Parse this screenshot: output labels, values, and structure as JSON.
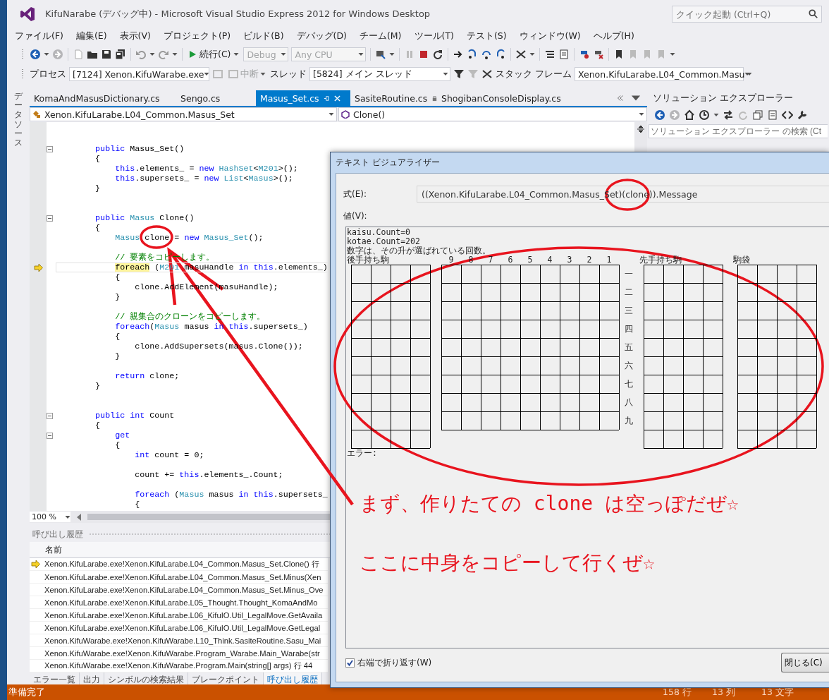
{
  "window": {
    "title": "KifuNarabe (デバッグ中) - Microsoft Visual Studio Express 2012 for Windows Desktop",
    "quick_launch": {
      "placeholder": "クイック起動 (Ctrl+Q)"
    }
  },
  "menu": [
    "ファイル(F)",
    "編集(E)",
    "表示(V)",
    "プロジェクト(P)",
    "ビルド(B)",
    "デバッグ(D)",
    "チーム(M)",
    "ツール(T)",
    "テスト(S)",
    "ウィンドウ(W)",
    "ヘルプ(H)"
  ],
  "toolbar": {
    "continue": "続行(C)",
    "configuration": {
      "value": "Debug",
      "disabled": true
    },
    "platform": {
      "value": "Any CPU",
      "disabled": true
    }
  },
  "debug_location": {
    "process_label": "プロセス",
    "process": "[7124] Xenon.KifuWarabe.exe",
    "suspend": {
      "label": "中断",
      "disabled": true
    },
    "thread_label": "スレッド",
    "thread": "[5824] メイン スレッド",
    "stack_frame_label": "スタック フレーム",
    "stack_frame": "Xenon.KifuLarabe.L04_Common.Masu"
  },
  "side_tab": "データソース",
  "tabs": [
    {
      "label": "KomaAndMasusDictionary.cs",
      "selected": false,
      "locked": false
    },
    {
      "label": "Sengo.cs",
      "selected": false,
      "locked": false
    },
    {
      "label": "Masus_Set.cs",
      "selected": true,
      "locked": false
    },
    {
      "label": "SasiteRoutine.cs",
      "selected": false,
      "locked": true
    },
    {
      "label": "ShogibanConsoleDisplay.cs",
      "selected": false,
      "locked": false
    }
  ],
  "nav": {
    "type": "Xenon.KifuLarabe.L04_Common.Masus_Set",
    "member": "Clone()"
  },
  "code": [
    {
      "fold": true,
      "current": false,
      "tokens": [
        {
          "kind": "keyword",
          "text": "        public"
        },
        {
          "kind": "plain",
          "text": " Masus_Set()"
        }
      ]
    },
    {
      "fold": false,
      "current": false,
      "tokens": [
        {
          "kind": "plain",
          "text": "        {"
        }
      ]
    },
    {
      "fold": false,
      "current": false,
      "tokens": [
        {
          "kind": "keyword",
          "text": "            this"
        },
        {
          "kind": "plain",
          "text": ".elements_ = "
        },
        {
          "kind": "keyword",
          "text": "new"
        },
        {
          "kind": "type",
          "text": " HashSet"
        },
        {
          "kind": "plain",
          "text": "<"
        },
        {
          "kind": "type",
          "text": "M201"
        },
        {
          "kind": "plain",
          "text": ">();"
        }
      ]
    },
    {
      "fold": false,
      "current": false,
      "tokens": [
        {
          "kind": "keyword",
          "text": "            this"
        },
        {
          "kind": "plain",
          "text": ".supersets_ = "
        },
        {
          "kind": "keyword",
          "text": "new"
        },
        {
          "kind": "type",
          "text": " List"
        },
        {
          "kind": "plain",
          "text": "<"
        },
        {
          "kind": "type",
          "text": "Masus"
        },
        {
          "kind": "plain",
          "text": ">();"
        }
      ]
    },
    {
      "fold": false,
      "current": false,
      "tokens": [
        {
          "kind": "plain",
          "text": "        }"
        }
      ]
    },
    {
      "fold": false,
      "current": false
    },
    {
      "fold": false,
      "current": false
    },
    {
      "fold": true,
      "current": false,
      "tokens": [
        {
          "kind": "keyword",
          "text": "        public"
        },
        {
          "kind": "type",
          "text": " Masus"
        },
        {
          "kind": "plain",
          "text": " Clone()"
        }
      ]
    },
    {
      "fold": false,
      "current": false,
      "tokens": [
        {
          "kind": "plain",
          "text": "        {"
        }
      ]
    },
    {
      "fold": false,
      "current": false,
      "tokens": [
        {
          "kind": "type",
          "text": "            Masus"
        },
        {
          "kind": "plain",
          "text": " clone = "
        },
        {
          "kind": "keyword",
          "text": "new"
        },
        {
          "kind": "type",
          "text": " Masus_Set"
        },
        {
          "kind": "plain",
          "text": "();"
        }
      ]
    },
    {
      "fold": false,
      "current": false
    },
    {
      "fold": false,
      "current": false,
      "tokens": [
        {
          "kind": "comment",
          "text": "            // 要素をコピーします。"
        }
      ]
    },
    {
      "fold": false,
      "current": true,
      "tokens": [
        {
          "kind": "current",
          "text": "            foreach"
        },
        {
          "kind": "plain",
          "text": " ("
        },
        {
          "kind": "type",
          "text": "M201"
        },
        {
          "kind": "plain",
          "text": " masuHandle "
        },
        {
          "kind": "keyword",
          "text": "in"
        },
        {
          "kind": "keyword",
          "text": " this"
        },
        {
          "kind": "plain",
          "text": ".elements_)"
        }
      ]
    },
    {
      "fold": false,
      "current": false,
      "tokens": [
        {
          "kind": "plain",
          "text": "            {"
        }
      ]
    },
    {
      "fold": false,
      "current": false,
      "tokens": [
        {
          "kind": "plain",
          "text": "                clone.AddElement(masuHandle);"
        }
      ]
    },
    {
      "fold": false,
      "current": false,
      "tokens": [
        {
          "kind": "plain",
          "text": "            }"
        }
      ]
    },
    {
      "fold": false,
      "current": false
    },
    {
      "fold": false,
      "current": false,
      "tokens": [
        {
          "kind": "comment",
          "text": "            // 親集合のクローンをコピーします。"
        }
      ]
    },
    {
      "fold": false,
      "current": false,
      "tokens": [
        {
          "kind": "keyword",
          "text": "            foreach"
        },
        {
          "kind": "plain",
          "text": "("
        },
        {
          "kind": "type",
          "text": "Masus"
        },
        {
          "kind": "plain",
          "text": " masus "
        },
        {
          "kind": "keyword",
          "text": "in"
        },
        {
          "kind": "keyword",
          "text": " this"
        },
        {
          "kind": "plain",
          "text": ".supersets_)"
        }
      ]
    },
    {
      "fold": false,
      "current": false,
      "tokens": [
        {
          "kind": "plain",
          "text": "            {"
        }
      ]
    },
    {
      "fold": false,
      "current": false,
      "tokens": [
        {
          "kind": "plain",
          "text": "                clone.AddSupersets(masus.Clone());"
        }
      ]
    },
    {
      "fold": false,
      "current": false,
      "tokens": [
        {
          "kind": "plain",
          "text": "            }"
        }
      ]
    },
    {
      "fold": false,
      "current": false
    },
    {
      "fold": false,
      "current": false,
      "tokens": [
        {
          "kind": "keyword",
          "text": "            return"
        },
        {
          "kind": "plain",
          "text": " clone;"
        }
      ]
    },
    {
      "fold": false,
      "current": false,
      "tokens": [
        {
          "kind": "plain",
          "text": "        }"
        }
      ]
    },
    {
      "fold": false,
      "current": false
    },
    {
      "fold": false,
      "current": false
    },
    {
      "fold": true,
      "current": false,
      "tokens": [
        {
          "kind": "keyword",
          "text": "        public"
        },
        {
          "kind": "keyword",
          "text": " int"
        },
        {
          "kind": "plain",
          "text": " Count"
        }
      ]
    },
    {
      "fold": false,
      "current": false,
      "tokens": [
        {
          "kind": "plain",
          "text": "        {"
        }
      ]
    },
    {
      "fold": true,
      "current": false,
      "tokens": [
        {
          "kind": "keyword",
          "text": "            get"
        }
      ]
    },
    {
      "fold": false,
      "current": false,
      "tokens": [
        {
          "kind": "plain",
          "text": "            {"
        }
      ]
    },
    {
      "fold": false,
      "current": false,
      "tokens": [
        {
          "kind": "keyword",
          "text": "                int"
        },
        {
          "kind": "plain",
          "text": " count = 0;"
        }
      ]
    },
    {
      "fold": false,
      "current": false
    },
    {
      "fold": false,
      "current": false,
      "tokens": [
        {
          "kind": "plain",
          "text": "                count += "
        },
        {
          "kind": "keyword",
          "text": "this"
        },
        {
          "kind": "plain",
          "text": ".elements_.Count;"
        }
      ]
    },
    {
      "fold": false,
      "current": false
    },
    {
      "fold": false,
      "current": false,
      "tokens": [
        {
          "kind": "keyword",
          "text": "                foreach"
        },
        {
          "kind": "plain",
          "text": " ("
        },
        {
          "kind": "type",
          "text": "Masus"
        },
        {
          "kind": "plain",
          "text": " masus "
        },
        {
          "kind": "keyword",
          "text": "in"
        },
        {
          "kind": "keyword",
          "text": " this"
        },
        {
          "kind": "plain",
          "text": ".supersets_"
        }
      ]
    },
    {
      "fold": false,
      "current": false,
      "tokens": [
        {
          "kind": "plain",
          "text": "                {"
        }
      ]
    }
  ],
  "zoom": "100 %",
  "call_stack": {
    "title": "呼び出し履歴",
    "column": "名前",
    "rows": [
      {
        "text": "Xenon.KifuLarabe.exe!Xenon.KifuLarabe.L04_Common.Masus_Set.Clone() 行",
        "current": true
      },
      {
        "text": "Xenon.KifuLarabe.exe!Xenon.KifuLarabe.L04_Common.Masus_Set.Minus(Xen",
        "current": false
      },
      {
        "text": "Xenon.KifuLarabe.exe!Xenon.KifuLarabe.L04_Common.Masus_Set.Minus_Ove",
        "current": false
      },
      {
        "text": "Xenon.KifuLarabe.exe!Xenon.KifuLarabe.L05_Thought.Thought_KomaAndMo",
        "current": false
      },
      {
        "text": "Xenon.KifuLarabe.exe!Xenon.KifuLarabe.L06_KifuIO.Util_LegalMove.GetAvaila",
        "current": false
      },
      {
        "text": "Xenon.KifuLarabe.exe!Xenon.KifuLarabe.L06_KifuIO.Util_LegalMove.GetLegal",
        "current": false
      },
      {
        "text": "Xenon.KifuWarabe.exe!Xenon.KifuWarabe.L10_Think.SasiteRoutine.Sasu_Mai",
        "current": false
      },
      {
        "text": "Xenon.KifuWarabe.exe!Xenon.KifuWarabe.Program_Warabe.Main_Warabe(str",
        "current": false
      },
      {
        "text": "Xenon.KifuWarabe.exe!Xenon.KifuWarabe.Program.Main(string[] args) 行 44",
        "current": false
      }
    ]
  },
  "bottom_tabs": [
    {
      "label": "エラー一覧",
      "selected": false
    },
    {
      "label": "出力",
      "selected": false
    },
    {
      "label": "シンボルの検索結果",
      "selected": false
    },
    {
      "label": "ブレークポイント",
      "selected": false
    },
    {
      "label": "呼び出し履歴",
      "selected": true
    }
  ],
  "status_bar": {
    "text": "準備完了",
    "line": "158 行",
    "column": "13 列",
    "char": "13 文字"
  },
  "solution_explorer": {
    "title": "ソリューション エクスプローラー",
    "search": {
      "placeholder": "ソリューション エクスプローラー の検索 (Ct"
    }
  },
  "dialog": {
    "title": "テキスト ビジュアライザー",
    "expression_label": "式(E):",
    "expression": "((Xenon.KifuLarabe.L04_Common.Masus_Set)(clone)).Message",
    "value_label": "値(V):",
    "value_lines": [
      "kaisu.Count=0",
      "kotae.Count=202",
      "数字は、その升が選ばれている回数。"
    ],
    "board": {
      "gote_label": "後手持ち駒",
      "files": [
        "9",
        "8",
        "7",
        "6",
        "5",
        "4",
        "3",
        "2",
        "1"
      ],
      "ranks": [
        "一",
        "二",
        "三",
        "四",
        "五",
        "六",
        "七",
        "八",
        "九"
      ],
      "sente_label": "先手持ち駒",
      "bag_label": "駒袋"
    },
    "error_label": "エラー:",
    "annotations": [
      "まず、作りたての clone は空っぽだぜ☆",
      "ここに中身をコピーして行くぜ☆"
    ],
    "wrap": {
      "label": "右端で折り返す(W)",
      "checked": true
    },
    "close_button": "閉じる(C)"
  }
}
